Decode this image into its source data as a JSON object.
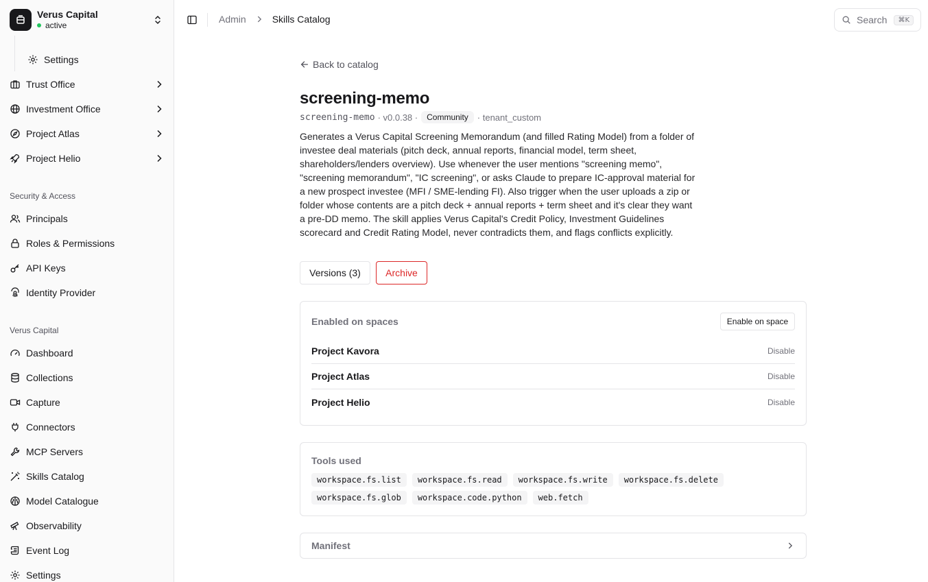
{
  "workspace": {
    "name": "Verus Capital",
    "status": "active"
  },
  "sidebar": {
    "partial_item": "Settings",
    "top_items": [
      {
        "label": "Trust Office"
      },
      {
        "label": "Investment Office"
      },
      {
        "label": "Project Atlas"
      },
      {
        "label": "Project Helio"
      }
    ],
    "security_group_label": "Security & Access",
    "security_items": [
      {
        "label": "Principals"
      },
      {
        "label": "Roles & Permissions"
      },
      {
        "label": "API Keys"
      },
      {
        "label": "Identity Provider"
      }
    ],
    "org_group_label": "Verus Capital",
    "org_items": [
      {
        "label": "Dashboard"
      },
      {
        "label": "Collections"
      },
      {
        "label": "Capture"
      },
      {
        "label": "Connectors"
      },
      {
        "label": "MCP Servers"
      },
      {
        "label": "Skills Catalog"
      },
      {
        "label": "Model Catalogue"
      },
      {
        "label": "Observability"
      },
      {
        "label": "Event Log"
      },
      {
        "label": "Settings"
      }
    ]
  },
  "header": {
    "breadcrumb_root": "Admin",
    "breadcrumb_current": "Skills Catalog",
    "search_label": "Search",
    "search_shortcut": "⌘K"
  },
  "skill": {
    "back_label": "Back to catalog",
    "title": "screening-memo",
    "slug": "screening-memo",
    "version": "· v0.0.38 ·",
    "badge": "Community",
    "source": "· tenant_custom",
    "description": "Generates a Verus Capital Screening Memorandum (and filled Rating Model) from a folder of investee deal materials (pitch deck, annual reports, financial model, term sheet, shareholders/lenders overview). Use whenever the user mentions \"screening memo\", \"screening memorandum\", \"IC screening\", or asks Claude to prepare IC-approval material for a new prospect investee (MFI / SME-lending FI). Also trigger when the user uploads a zip or folder whose contents are a pitch deck + annual reports + term sheet and it's clear they want a pre-DD memo. The skill applies Verus Capital's Credit Policy, Investment Guidelines scorecard and Credit Rating Model, never contradicts them, and flags conflicts explicitly.",
    "versions_button": "Versions (3)",
    "archive_button": "Archive"
  },
  "spaces": {
    "title": "Enabled on spaces",
    "enable_button": "Enable on space",
    "rows": [
      {
        "name": "Project Kavora",
        "action": "Disable"
      },
      {
        "name": "Project Atlas",
        "action": "Disable"
      },
      {
        "name": "Project Helio",
        "action": "Disable"
      }
    ]
  },
  "tools": {
    "title": "Tools used",
    "items": [
      "workspace.fs.list",
      "workspace.fs.read",
      "workspace.fs.write",
      "workspace.fs.delete",
      "workspace.fs.glob",
      "workspace.code.python",
      "web.fetch"
    ]
  },
  "manifest": {
    "label": "Manifest"
  },
  "colors": {
    "accent_danger": "#dc2626",
    "status_active": "#22c55e",
    "sidebar_bg": "#fafafa"
  }
}
